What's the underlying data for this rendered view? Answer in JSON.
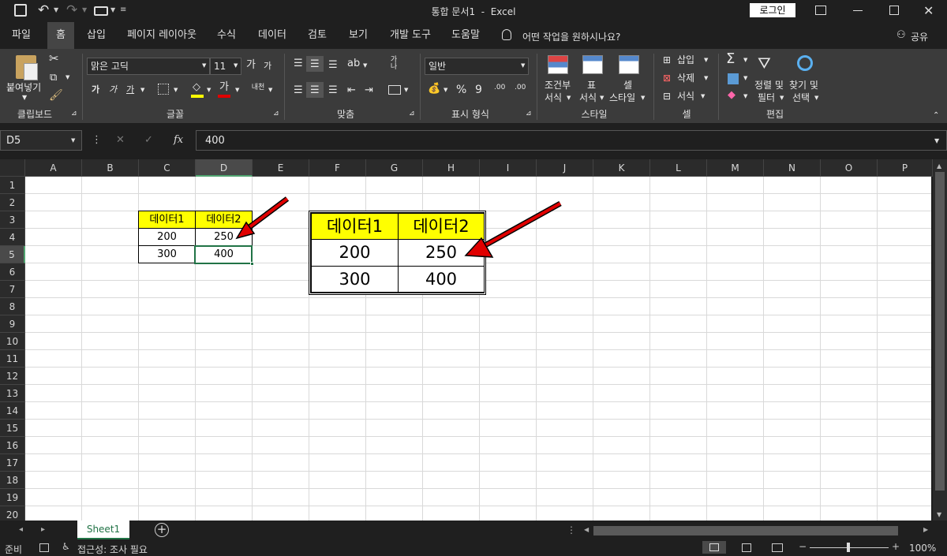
{
  "title_bar": {
    "title": "통합 문서1  -  Excel",
    "login_label": "로그인"
  },
  "tabs": [
    "파일",
    "홈",
    "삽입",
    "페이지 레이아웃",
    "수식",
    "데이터",
    "검토",
    "보기",
    "개발 도구",
    "도움말"
  ],
  "active_tab": "홈",
  "tell_me": "어떤 작업을 원하시나요?",
  "share_label": "공유",
  "ribbon": {
    "clipboard": {
      "paste_label": "붙여넣기",
      "group_label": "클립보드"
    },
    "font": {
      "font_name": "맑은 고딕",
      "font_size": "11",
      "grow_label": "가",
      "shrink_label": "가",
      "bold": "가",
      "italic": "가",
      "underline": "가",
      "font_color_glyph": "가",
      "phonetic": "내천",
      "group_label": "글꼴"
    },
    "alignment": {
      "wrap_label": "가나",
      "group_label": "맞춤"
    },
    "number": {
      "format": "일반",
      "percent": "%",
      "comma": "9",
      "group_label": "표시 형식"
    },
    "styles": {
      "conditional": [
        "조건부",
        "서식"
      ],
      "table": [
        "표",
        "서식"
      ],
      "cell": [
        "셀",
        "스타일"
      ],
      "group_label": "스타일"
    },
    "cells": {
      "insert": "삽입",
      "delete": "삭제",
      "format": "서식",
      "group_label": "셀"
    },
    "editing": {
      "sort": [
        "정렬 및",
        "필터"
      ],
      "find": [
        "찾기 및",
        "선택"
      ],
      "group_label": "편집"
    }
  },
  "formula_bar": {
    "name_box": "D5",
    "formula": "400",
    "fx": "fx"
  },
  "columns": [
    "A",
    "B",
    "C",
    "D",
    "E",
    "F",
    "G",
    "H",
    "I",
    "J",
    "K",
    "L",
    "M",
    "N",
    "O",
    "P"
  ],
  "rows": [
    "1",
    "2",
    "3",
    "4",
    "5",
    "6",
    "7",
    "8",
    "9",
    "10",
    "11",
    "12",
    "13",
    "14",
    "15",
    "16",
    "17",
    "18",
    "19",
    "20"
  ],
  "selected_cell": "D5",
  "table_small": {
    "headers": [
      "데이터1",
      "데이터2"
    ],
    "rows": [
      [
        "200",
        "250"
      ],
      [
        "300",
        "400"
      ]
    ]
  },
  "table_large": {
    "headers": [
      "데이터1",
      "데이터2"
    ],
    "rows": [
      [
        "200",
        "250"
      ],
      [
        "300",
        "400"
      ]
    ]
  },
  "sheets": [
    "Sheet1"
  ],
  "status": {
    "ready": "준비",
    "accessibility": "접근성: 조사 필요",
    "zoom": "100%"
  },
  "colors": {
    "header_fill": "#ffff00",
    "selection": "#217346",
    "arrow": "#e00000"
  }
}
